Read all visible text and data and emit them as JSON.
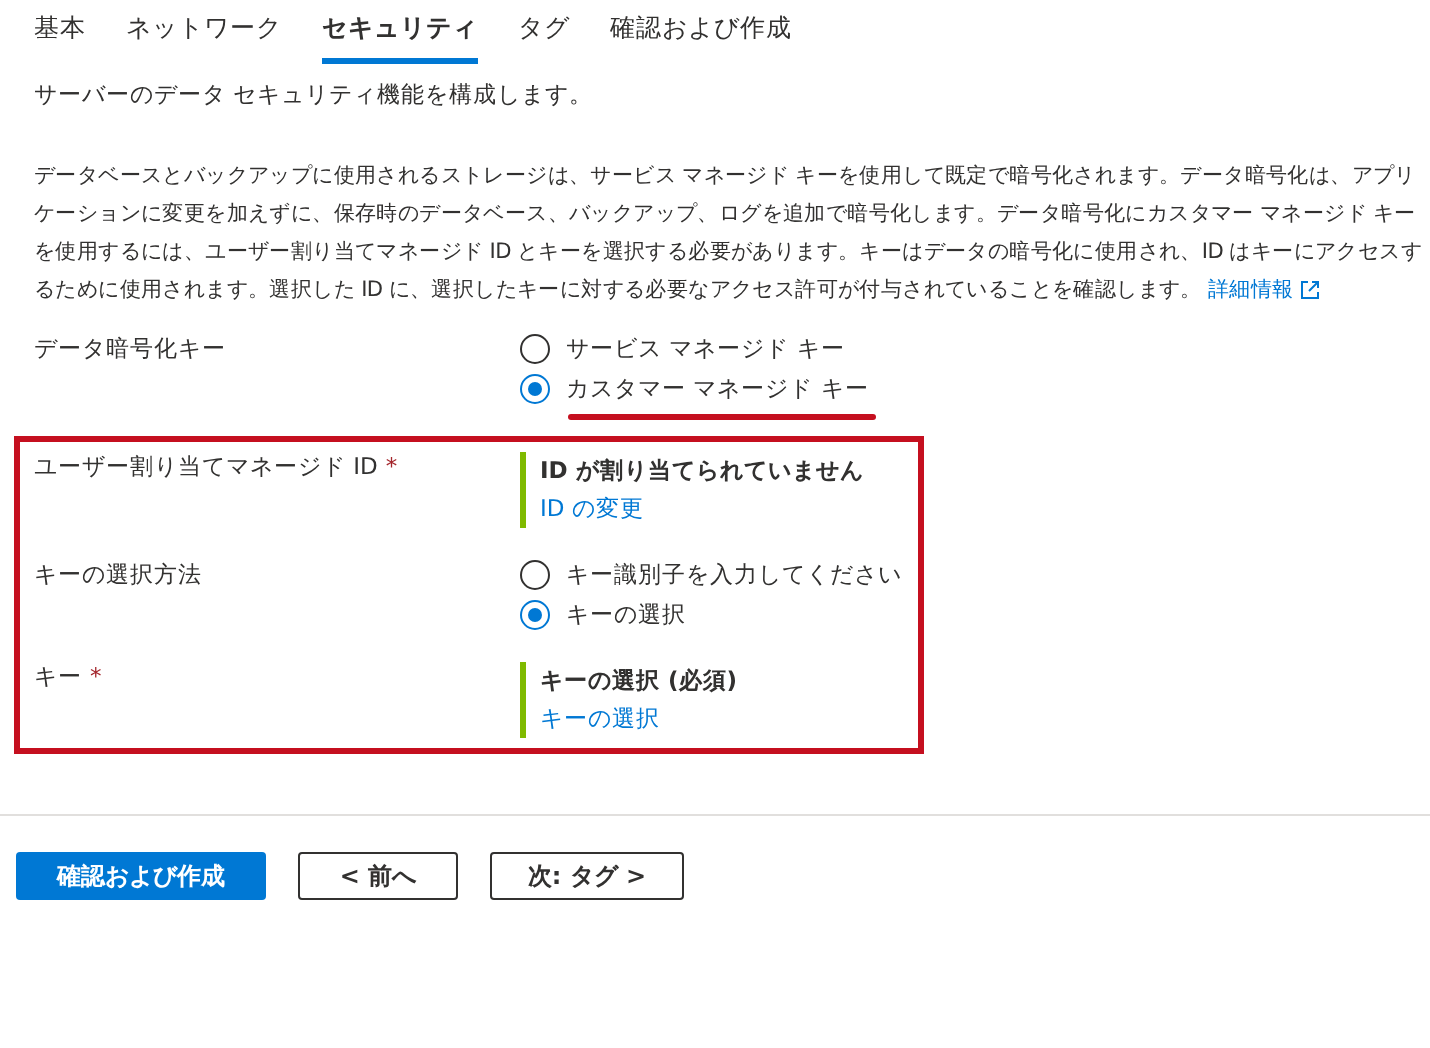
{
  "tabs": [
    {
      "label": "基本",
      "selected": false
    },
    {
      "label": "ネットワーク",
      "selected": false
    },
    {
      "label": "セキュリティ",
      "selected": true
    },
    {
      "label": "タグ",
      "selected": false
    },
    {
      "label": "確認および作成",
      "selected": false
    }
  ],
  "subtitle": "サーバーのデータ セキュリティ機能を構成します。",
  "description": {
    "text": "データベースとバックアップに使用されるストレージは、サービス マネージド キーを使用して既定で暗号化されます。データ暗号化は、アプリケーションに変更を加えずに、保存時のデータベース、バックアップ、ログを追加で暗号化します。データ暗号化にカスタマー マネージド キーを使用するには、ユーザー割り当てマネージド ID とキーを選択する必要があります。キーはデータの暗号化に使用され、ID はキーにアクセスするために使用されます。選択した ID に、選択したキーに対する必要なアクセス許可が付与されていることを確認します。",
    "link": "詳細情報"
  },
  "fields": [
    {
      "kind": "radio",
      "label": "データ暗号化キー",
      "highlighted": false,
      "options": [
        {
          "label": "サービス マネージド キー",
          "selected": false,
          "underlined": false
        },
        {
          "label": "カスタマー マネージド キー",
          "selected": true,
          "underlined": true
        }
      ]
    },
    {
      "kind": "picker",
      "label": "ユーザー割り当てマネージド ID",
      "required_mark": "*",
      "highlighted": true,
      "value": "ID が割り当てられていません",
      "link": "ID の変更"
    },
    {
      "kind": "radio",
      "label": "キーの選択方法",
      "highlighted": true,
      "options": [
        {
          "label": "キー識別子を入力してください",
          "selected": false,
          "underlined": false
        },
        {
          "label": "キーの選択",
          "selected": true,
          "underlined": false
        }
      ]
    },
    {
      "kind": "picker",
      "label": "キー",
      "required_mark": "*",
      "highlighted": true,
      "value": "キーの選択 (必須)",
      "link": "キーの選択"
    }
  ],
  "buttons": [
    {
      "label": "確認および作成",
      "kind": "primary"
    },
    {
      "label": "< 前へ",
      "kind": "secondary"
    },
    {
      "label": "次: タグ >",
      "kind": "secondary"
    }
  ]
}
